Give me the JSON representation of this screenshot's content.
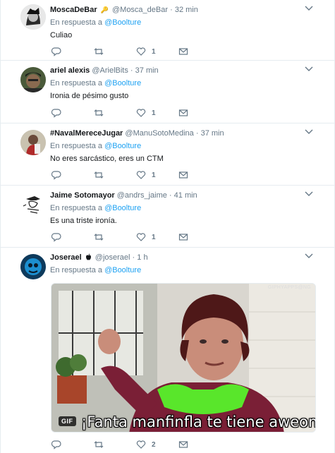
{
  "reply_prefix": "En respuesta a",
  "tweets": [
    {
      "name": "MoscaDeBar",
      "badge": "🔑",
      "handle": "@Mosca_deBar",
      "time": "32 min",
      "reply_to": "@Boolture",
      "text": "Culiao",
      "likes": "1",
      "avatar_color": "#3a3a3a"
    },
    {
      "name": "ariel alexis",
      "handle": "@ArielBits",
      "time": "37 min",
      "reply_to": "@Boolture",
      "text": "Ironia de pésimo gusto",
      "likes": "1",
      "avatar_color": "#5b4a3a"
    },
    {
      "name": "#NavalMereceJugar",
      "handle": "@ManuSotoMedina",
      "time": "37 min",
      "reply_to": "@Boolture",
      "text": "No eres sarcástico, eres un CTM",
      "likes": "1",
      "avatar_color": "#6a4a3a"
    },
    {
      "name": "Jaime Sotomayor",
      "handle": "@andrs_jaime",
      "time": "41 min",
      "reply_to": "@Boolture",
      "text": "Es una triste ironía.",
      "likes": "1",
      "avatar_color": "#ffffff"
    },
    {
      "name": "Joserael",
      "badge": "",
      "handle": "@joserael",
      "time": "1 h",
      "reply_to": "@Boolture",
      "likes": "2",
      "avatar_color": "#1c6d9c",
      "media": {
        "type": "GIF",
        "caption": "¡Fanta manfinfla te tiene aweonao!",
        "watermark": "GIPHYAPPS@NG"
      }
    }
  ],
  "colors": {
    "accent": "#1da1f2",
    "muted": "#657786",
    "border": "#e6ecf0"
  }
}
